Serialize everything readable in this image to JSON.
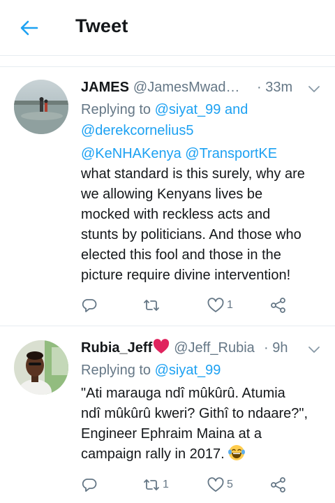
{
  "header": {
    "title": "Tweet"
  },
  "tweets": [
    {
      "display_name": "JAMES",
      "handle": "@JamesMwad…",
      "time": "· 33m",
      "replying_prefix": "Replying to ",
      "replying_line1_mention": "@siyat_99",
      "replying_and": " and",
      "replying_line2_mention": "@derekcornelius5",
      "body_mention_1": "@KeNHAKenya",
      "body_mention_2": "@TransportKE",
      "body_lines": [
        "what standard is this surely, why are",
        "we allowing Kenyans lives be",
        "mocked with reckless acts and",
        "stunts by politicians. And those who",
        "elected this fool and those in the",
        "picture require divine intervention!"
      ],
      "actions": {
        "reply_count": "",
        "retweet_count": "",
        "like_count": "1"
      }
    },
    {
      "display_name": "Rubia_Jeff",
      "handle": "@Jeff_Rubia",
      "time": "· 9h",
      "replying_prefix": "Replying to ",
      "replying_line1_mention": "@siyat_99",
      "body_lines": [
        "\"Ati marauga ndî mûkûrû. Atumia",
        "ndî mûkûrû kweri? Githî to ndaare?\",",
        "Engineer Ephraim Maina at a",
        "campaign rally in 2017."
      ],
      "actions": {
        "reply_count": "",
        "retweet_count": "1",
        "like_count": "5"
      }
    }
  ],
  "colors": {
    "accent": "#1da1f2",
    "secondary_text": "#657786",
    "divider": "#e6ecf0",
    "heart": "#e0245e"
  },
  "icons": [
    "back-arrow-icon",
    "chevron-down-icon",
    "reply-icon",
    "retweet-icon",
    "like-icon",
    "share-icon",
    "red-heart-emoji",
    "laughing-emoji"
  ]
}
